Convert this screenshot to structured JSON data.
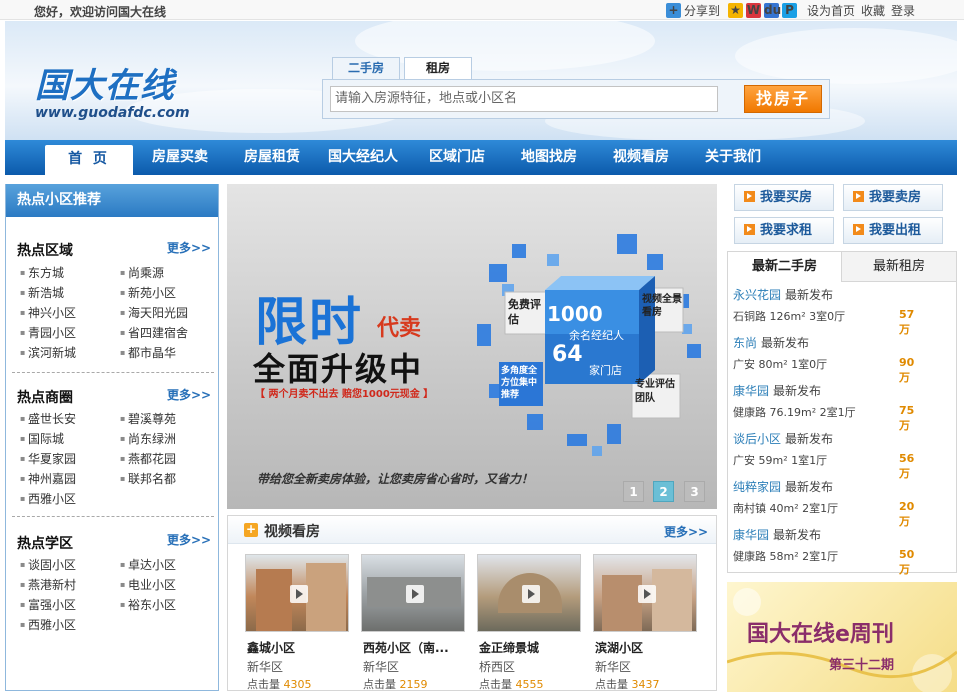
{
  "topbar": {
    "welcome": "您好，欢迎访问国大在线",
    "share": "分享到",
    "set_home": "设为首页",
    "favorite": "收藏",
    "login": "登录"
  },
  "header": {
    "logo_cn": "国大在线",
    "logo_en": "www.guodafdc.com",
    "tabs": [
      "二手房",
      "租房"
    ],
    "active_tab": "租房",
    "search_placeholder": "请输入房源特征，地点或小区名",
    "search_button": "找房子"
  },
  "nav": {
    "items": [
      "首 页",
      "房屋买卖",
      "房屋租赁",
      "国大经纪人",
      "区域门店",
      "地图找房",
      "视频看房",
      "关于我们"
    ],
    "active": "首 页"
  },
  "left": {
    "title": "热点小区推荐",
    "more": "更多>>",
    "sections": [
      {
        "title": "热点区域",
        "items": [
          "东方城",
          "尚乘源",
          "新浩城",
          "新苑小区",
          "神兴小区",
          "海天阳光园",
          "青园小区",
          "省四建宿舍",
          "滨河新城",
          "都市晶华"
        ]
      },
      {
        "title": "热点商圈",
        "items": [
          "盛世长安",
          "碧溪尊苑",
          "国际城",
          "尚东绿洲",
          "华夏家园",
          "燕都花园",
          "神州嘉园",
          "联邦名都",
          "西雅小区"
        ]
      },
      {
        "title": "热点学区",
        "items": [
          "谈固小区",
          "卓达小区",
          "燕港新村",
          "电业小区",
          "富强小区",
          "裕东小区",
          "西雅小区"
        ]
      }
    ]
  },
  "banner": {
    "title_big": "限时",
    "title_small": "代卖",
    "subtitle": "全面升级中",
    "promo": "【 两个月卖不出去  赔您1000元现金 】",
    "cube": {
      "agents_num": "1000",
      "agents_label": "余名经纪人",
      "stores_num": "64",
      "stores_label": "家门店",
      "left_top": "免费评估",
      "right_top": "视频全景看房",
      "left_bottom": "多角度全方位集中推荐",
      "right_bottom": "专业评估团队"
    },
    "slogan": "带给您全新卖房体验，让您卖房省心省时，又省力！",
    "pages": [
      "1",
      "2",
      "3"
    ],
    "active_page": "2"
  },
  "video": {
    "title": "视频看房",
    "more": "更多>>",
    "click_label": "点击量",
    "items": [
      {
        "name": "鑫城小区",
        "district": "新华区",
        "clicks": "4305"
      },
      {
        "name": "西苑小区（南...",
        "district": "新华区",
        "clicks": "2159"
      },
      {
        "name": "金正缔景城",
        "district": "桥西区",
        "clicks": "4555"
      },
      {
        "name": "滨湖小区",
        "district": "新华区",
        "clicks": "3437"
      }
    ]
  },
  "right": {
    "buttons": [
      "我要买房",
      "我要卖房",
      "我要求租",
      "我要出租"
    ],
    "tabs": [
      "最新二手房",
      "最新租房"
    ],
    "active_tab": "最新二手房",
    "tag": "最新发布",
    "listings": [
      {
        "community": "永兴花园",
        "location": "石铜路",
        "detail": "126m² 3室0厅",
        "price": "57万"
      },
      {
        "community": "东尚",
        "location": "广安",
        "detail": "80m² 1室0厅",
        "price": "90万"
      },
      {
        "community": "康华园",
        "location": "健康路",
        "detail": "76.19m² 2室1厅",
        "price": "75万"
      },
      {
        "community": "谈后小区",
        "location": "广安",
        "detail": "59m² 1室1厅",
        "price": "56万"
      },
      {
        "community": "纯粹家园",
        "location": "南村镇",
        "detail": "40m² 2室1厅",
        "price": "20万"
      },
      {
        "community": "康华园",
        "location": "健康路",
        "detail": "58m² 2室1厅",
        "price": "50万"
      }
    ],
    "ebanner_title": "国大在线e周刊",
    "ebanner_issue": "第三十二期"
  },
  "colors": {
    "nav_blue": "#1568b8",
    "accent_orange": "#f07800",
    "link_blue": "#2d7fb8",
    "price_orange": "#e08a00"
  }
}
